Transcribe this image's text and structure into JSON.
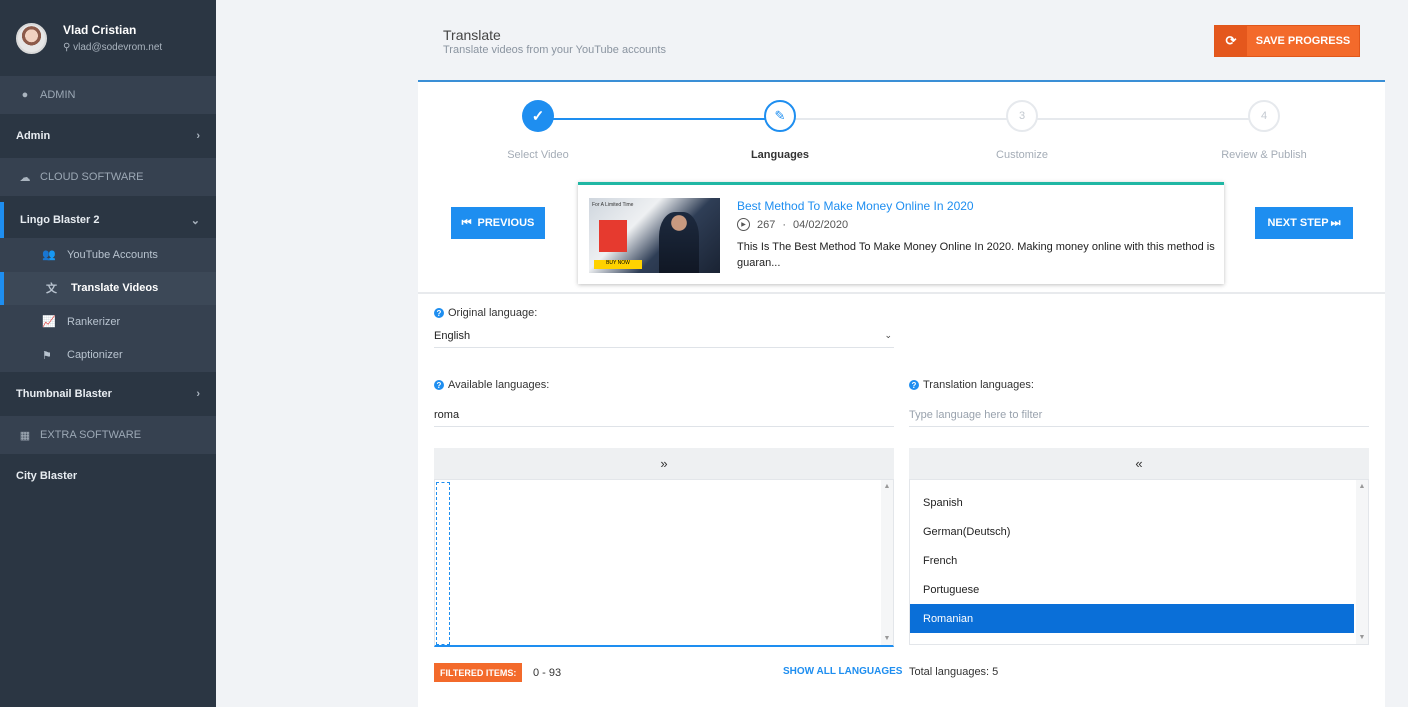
{
  "user": {
    "name": "Vlad Cristian",
    "email": "vlad@sodevrom.net"
  },
  "sidebar": {
    "sections": [
      {
        "icon": "user-icon",
        "label": "ADMIN"
      },
      {
        "icon": "cloud-icon",
        "label": "CLOUD SOFTWARE"
      },
      {
        "icon": "grid-icon",
        "label": "EXTRA SOFTWARE"
      }
    ],
    "admin": "Admin",
    "lingo": "Lingo Blaster 2",
    "sub_items": [
      {
        "icon": "users-icon",
        "label": "YouTube Accounts"
      },
      {
        "icon": "translate-icon",
        "label": "Translate Videos"
      },
      {
        "icon": "chart-line-icon",
        "label": "Rankerizer"
      },
      {
        "icon": "flag-icon",
        "label": "Captionizer"
      }
    ],
    "thumbnail": "Thumbnail Blaster",
    "city": "City Blaster"
  },
  "header": {
    "title": "Translate",
    "subtitle": "Translate videos from your YouTube accounts",
    "save_label": "SAVE PROGRESS"
  },
  "stepper": {
    "steps": [
      {
        "num": "1",
        "label": "Select Video",
        "state": "done"
      },
      {
        "num": "2",
        "label": "Languages",
        "state": "active"
      },
      {
        "num": "3",
        "label": "Customize",
        "state": "todo"
      },
      {
        "num": "4",
        "label": "Review & Publish",
        "state": "todo"
      }
    ]
  },
  "nav": {
    "previous": "PREVIOUS",
    "next": "NEXT STEP"
  },
  "video": {
    "title": "Best Method To Make Money Online In 2020",
    "views": "267",
    "date": "04/02/2020",
    "description": "This Is The Best Method To Make Money Online In 2020. Making money online with this method is guaran...",
    "thumb_text": "For A Limited Time",
    "thumb_badge": "BUY NOW"
  },
  "original": {
    "label": "Original language:",
    "value": "English"
  },
  "available": {
    "label": "Available languages:",
    "filter": "roma",
    "move_label": "»",
    "filtered_badge": "FILTERED ITEMS:",
    "range": "0 - 93",
    "show_all": "SHOW ALL LANGUAGES"
  },
  "translation": {
    "label": "Translation languages:",
    "placeholder": "Type language here to filter",
    "move_label": "«",
    "languages": [
      "Spanish",
      "German(Deutsch)",
      "French",
      "Portuguese",
      "Romanian"
    ],
    "selected": "Romanian",
    "total": "Total languages: 5"
  },
  "colors": {
    "accent": "#1e8ef0",
    "orange": "#f36a2b",
    "sidebar": "#2b3643",
    "teal": "#20b7a4"
  }
}
